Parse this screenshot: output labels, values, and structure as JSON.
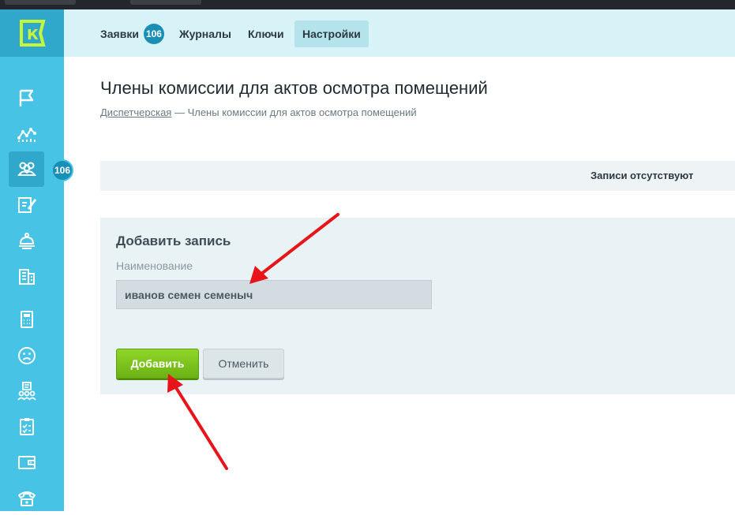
{
  "sidebar": {
    "logo_letter": "К",
    "badge_count": "106",
    "items": [
      {
        "icon": "flag-icon"
      },
      {
        "icon": "analytics-icon"
      },
      {
        "icon": "users-group-icon",
        "active": true
      },
      {
        "icon": "edit-document-icon"
      },
      {
        "icon": "bell-service-icon"
      },
      {
        "icon": "building-icon"
      },
      {
        "icon": "calculator-icon"
      },
      {
        "icon": "sad-face-icon"
      },
      {
        "icon": "people-list-icon"
      },
      {
        "icon": "clipboard-icon"
      },
      {
        "icon": "wallet-icon"
      },
      {
        "icon": "phone-icon"
      }
    ]
  },
  "topnav": {
    "requests_label": "Заявки",
    "requests_badge": "106",
    "journals_label": "Журналы",
    "keys_label": "Ключи",
    "settings_label": "Настройки"
  },
  "page": {
    "title": "Члены комиссии для актов осмотра помещений",
    "breadcrumb_link": "Диспетчерская",
    "breadcrumb_current": "— Члены комиссии для актов осмотра помещений",
    "empty_message": "Записи отсутствуют"
  },
  "form": {
    "title": "Добавить запись",
    "name_label": "Наименование",
    "name_value": "иванов семен семеныч",
    "add_label": "Добавить",
    "cancel_label": "Отменить"
  },
  "colors": {
    "sidebar": "#47c3e6",
    "sidebar_dark": "#2fa8cc",
    "topnav": "#d8f3f8",
    "accent_green": "#7cc61e",
    "badge": "#1a8fb5",
    "annotation_red": "#e8141a"
  }
}
